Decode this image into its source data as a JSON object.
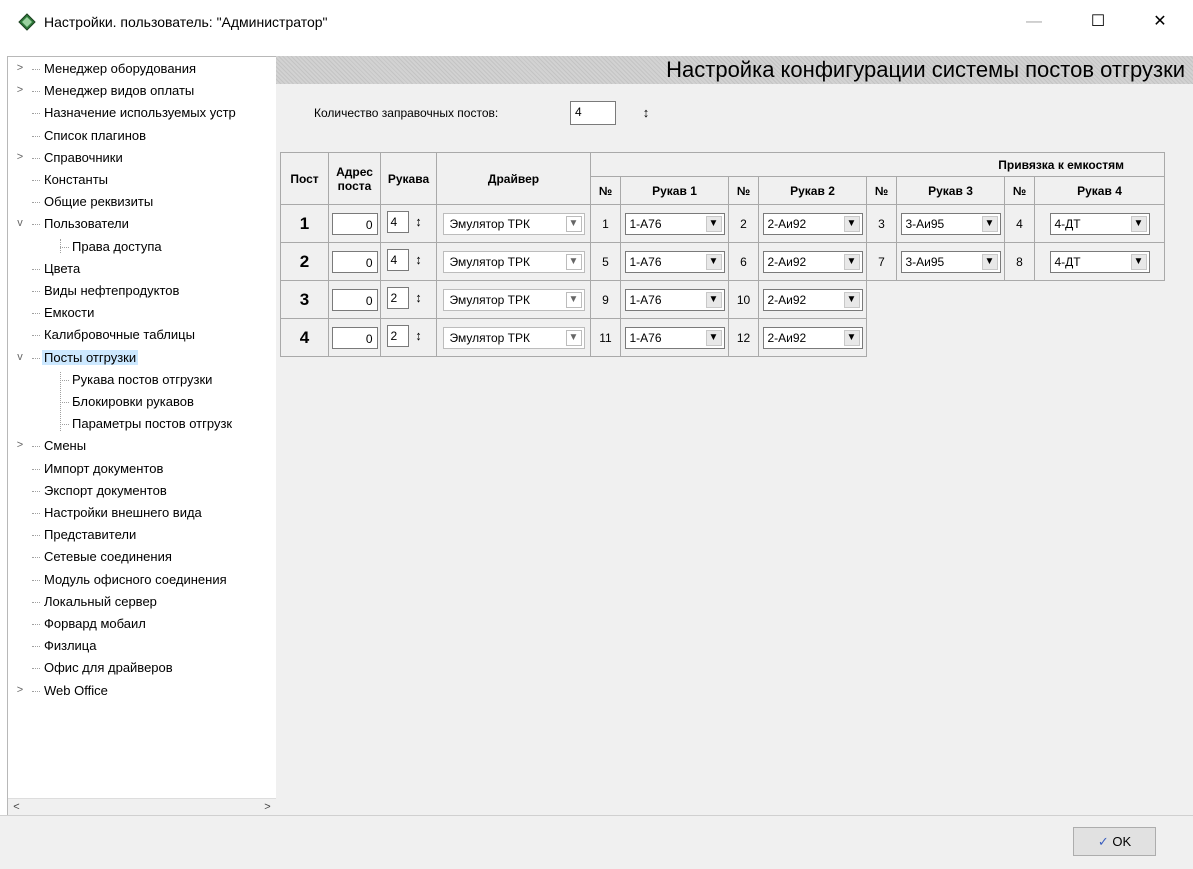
{
  "window": {
    "title": "Настройки. пользователь: \"Администратор\"",
    "minimize": "—",
    "maximize": "☐",
    "close": "✕"
  },
  "tree": {
    "items": [
      {
        "label": "Менеджер оборудования",
        "expander": ">"
      },
      {
        "label": "Менеджер видов оплаты",
        "expander": ">"
      },
      {
        "label": "Назначение используемых устр",
        "expander": ""
      },
      {
        "label": "Список плагинов",
        "expander": ""
      },
      {
        "label": "Справочники",
        "expander": ">"
      },
      {
        "label": "Константы",
        "expander": ""
      },
      {
        "label": "Общие реквизиты",
        "expander": ""
      },
      {
        "label": "Пользователи",
        "expander": "v"
      },
      {
        "label": "Права доступа",
        "expander": ""
      },
      {
        "label": "Цвета",
        "expander": ""
      },
      {
        "label": "Виды нефтепродуктов",
        "expander": ""
      },
      {
        "label": "Емкости",
        "expander": ""
      },
      {
        "label": "Калибровочные таблицы",
        "expander": ""
      },
      {
        "label": "Посты отгрузки",
        "expander": "v"
      },
      {
        "label": "Рукава постов отгрузки",
        "expander": ""
      },
      {
        "label": "Блокировки рукавов",
        "expander": ""
      },
      {
        "label": "Параметры постов отгрузк",
        "expander": ""
      },
      {
        "label": "Смены",
        "expander": ">"
      },
      {
        "label": "Импорт документов",
        "expander": ""
      },
      {
        "label": "Экспорт документов",
        "expander": ""
      },
      {
        "label": "Настройки внешнего вида",
        "expander": ""
      },
      {
        "label": "Представители",
        "expander": ""
      },
      {
        "label": "Сетевые соединения",
        "expander": ""
      },
      {
        "label": "Модуль офисного соединения",
        "expander": ""
      },
      {
        "label": "Локальный сервер",
        "expander": ""
      },
      {
        "label": "Форвард мобаил",
        "expander": ""
      },
      {
        "label": "Физлица",
        "expander": ""
      },
      {
        "label": "Офис для драйверов",
        "expander": ""
      },
      {
        "label": "Web Office",
        "expander": ">"
      }
    ],
    "scroll_left": "<",
    "scroll_right": ">"
  },
  "main": {
    "header_title": "Настройка конфигурации системы постов отгрузки",
    "posts_count_label": "Количество заправочных постов:",
    "posts_count_value": "4",
    "spin_glyph": "↕"
  },
  "table": {
    "headers": {
      "post": "Пост",
      "address": "Адрес поста",
      "hoses": "Рукава",
      "driver": "Драйвер",
      "binding": "Привязка к емкостям",
      "no": "№",
      "hose1": "Рукав 1",
      "hose2": "Рукав 2",
      "hose3": "Рукав 3",
      "hose4": "Рукав 4"
    },
    "rows": [
      {
        "post": "1",
        "address": "0",
        "hoses": "4",
        "driver": "Эмулятор ТРК",
        "tanks": [
          {
            "no": "1",
            "value": "1-А76"
          },
          {
            "no": "2",
            "value": "2-Аи92"
          },
          {
            "no": "3",
            "value": "3-Аи95"
          },
          {
            "no": "4",
            "value": "4-ДТ"
          }
        ]
      },
      {
        "post": "2",
        "address": "0",
        "hoses": "4",
        "driver": "Эмулятор ТРК",
        "tanks": [
          {
            "no": "5",
            "value": "1-А76"
          },
          {
            "no": "6",
            "value": "2-Аи92"
          },
          {
            "no": "7",
            "value": "3-Аи95"
          },
          {
            "no": "8",
            "value": "4-ДТ"
          }
        ]
      },
      {
        "post": "3",
        "address": "0",
        "hoses": "2",
        "driver": "Эмулятор ТРК",
        "tanks": [
          {
            "no": "9",
            "value": "1-А76"
          },
          {
            "no": "10",
            "value": "2-Аи92"
          }
        ]
      },
      {
        "post": "4",
        "address": "0",
        "hoses": "2",
        "driver": "Эмулятор ТРК",
        "tanks": [
          {
            "no": "11",
            "value": "1-А76"
          },
          {
            "no": "12",
            "value": "2-Аи92"
          }
        ]
      }
    ]
  },
  "footer": {
    "ok_label": "OK"
  }
}
